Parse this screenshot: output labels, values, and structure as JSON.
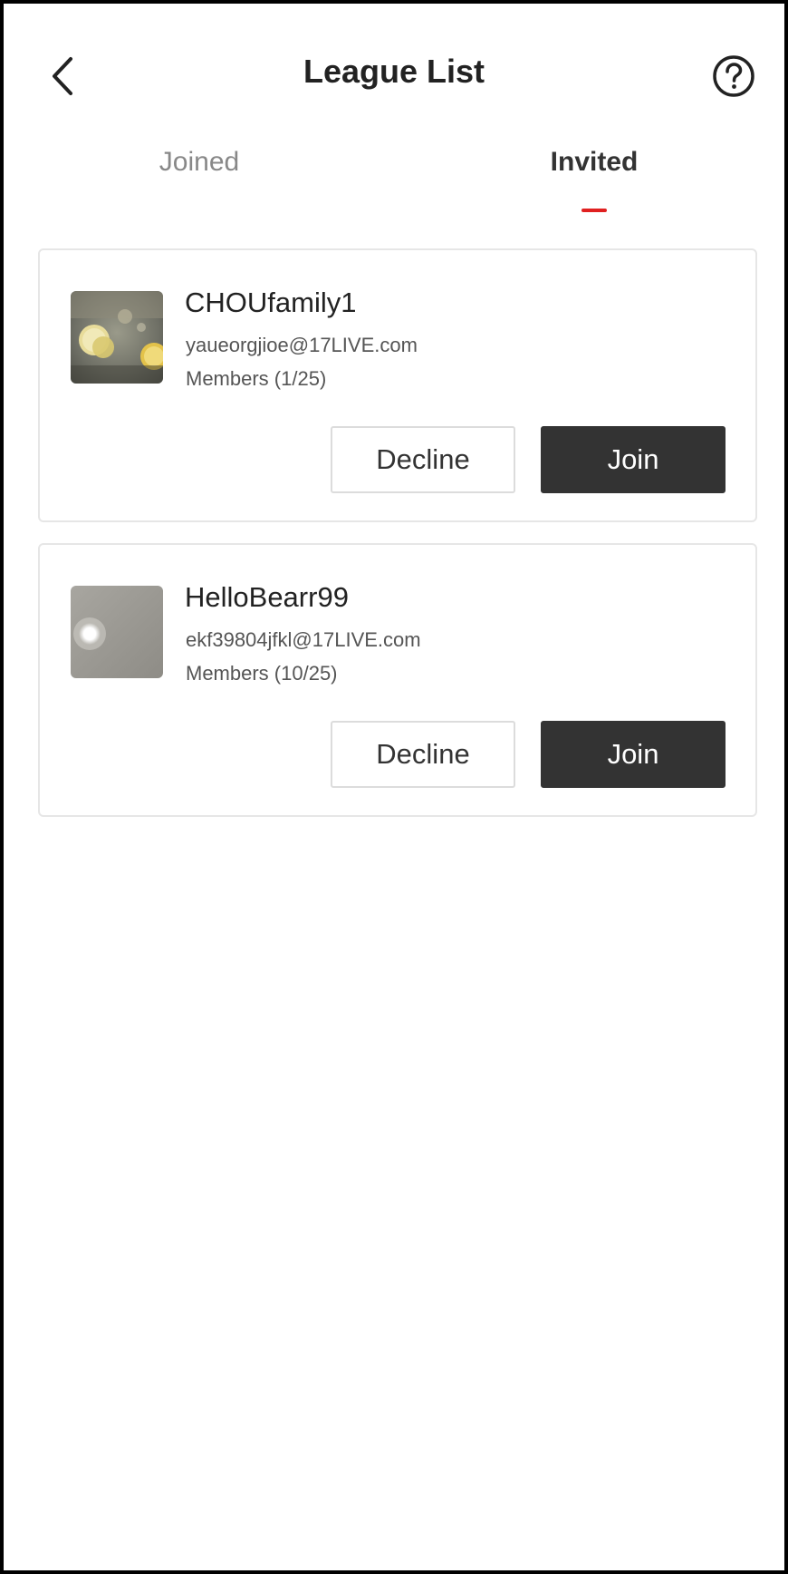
{
  "header": {
    "title": "League List",
    "back_icon": "chevron-left-icon",
    "help_icon": "question-circle-icon"
  },
  "tabs": [
    {
      "label": "Joined",
      "active": false
    },
    {
      "label": "Invited",
      "active": true
    }
  ],
  "invitations": [
    {
      "name": "CHOUfamily1",
      "email": "yaueorgjioe@17LIVE.com",
      "members": "Members (1/25)",
      "decline_label": "Decline",
      "join_label": "Join"
    },
    {
      "name": "HelloBearr99",
      "email": "ekf39804jfkl@17LIVE.com",
      "members": "Members (10/25)",
      "decline_label": "Decline",
      "join_label": "Join"
    }
  ],
  "colors": {
    "accent": "#e02020",
    "primary_button": "#333333",
    "text_primary": "#222222",
    "text_secondary": "#555555",
    "tab_inactive": "#888888"
  }
}
